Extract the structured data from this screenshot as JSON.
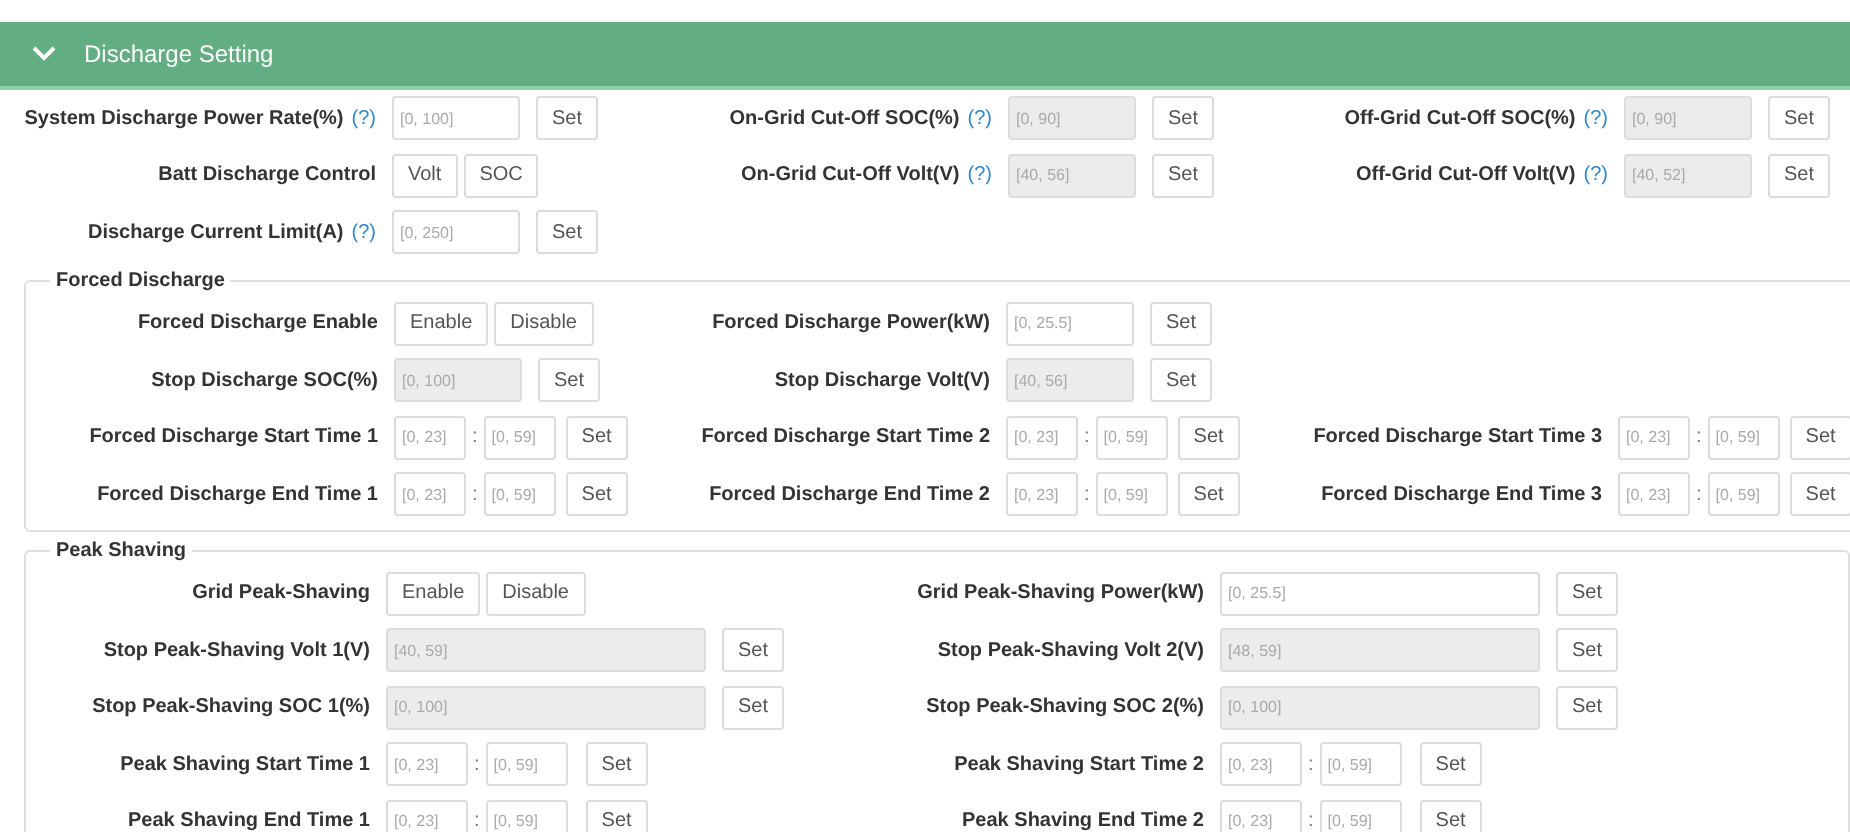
{
  "header": {
    "title": "Discharge Setting",
    "expanded": true
  },
  "sections": [
    {
      "rows": [
        [
          {
            "kind": "input",
            "label": "System Discharge Power Rate(%)",
            "help": "(?)",
            "placeholder": "[0, 100]",
            "disabled": false,
            "button": "Set"
          },
          {
            "kind": "input",
            "label": "On-Grid Cut-Off SOC(%)",
            "help": "(?)",
            "placeholder": "[0, 90]",
            "disabled": true,
            "button": "Set"
          },
          {
            "kind": "input",
            "label": "Off-Grid Cut-Off SOC(%)",
            "help": "(?)",
            "placeholder": "[0, 90]",
            "disabled": true,
            "button": "Set"
          }
        ],
        [
          {
            "kind": "toggle",
            "label": "Batt Discharge Control",
            "options": [
              "Volt",
              "SOC"
            ]
          },
          {
            "kind": "input",
            "label": "On-Grid Cut-Off Volt(V)",
            "help": "(?)",
            "placeholder": "[40, 56]",
            "disabled": true,
            "button": "Set"
          },
          {
            "kind": "input",
            "label": "Off-Grid Cut-Off Volt(V)",
            "help": "(?)",
            "placeholder": "[40, 52]",
            "disabled": true,
            "button": "Set"
          }
        ],
        [
          {
            "kind": "input",
            "label": "Discharge Current Limit(A)",
            "help": "(?)",
            "placeholder": "[0, 250]",
            "disabled": false,
            "button": "Set"
          }
        ]
      ]
    },
    {
      "legend": "Forced Discharge",
      "rows": [
        [
          {
            "kind": "toggle",
            "label": "Forced Discharge Enable",
            "options": [
              "Enable",
              "Disable"
            ]
          },
          {
            "kind": "input",
            "label": "Forced Discharge Power(kW)",
            "placeholder": "[0, 25.5]",
            "disabled": false,
            "button": "Set"
          }
        ],
        [
          {
            "kind": "input",
            "label": "Stop Discharge SOC(%)",
            "placeholder": "[0, 100]",
            "disabled": true,
            "button": "Set"
          },
          {
            "kind": "input",
            "label": "Stop Discharge Volt(V)",
            "placeholder": "[40, 56]",
            "disabled": true,
            "button": "Set"
          }
        ],
        [
          {
            "kind": "time",
            "label": "Forced Discharge Start Time 1",
            "hour": {
              "placeholder": "[0, 23]"
            },
            "separator": ":",
            "minute": {
              "placeholder": "[0, 59]"
            },
            "button": "Set"
          },
          {
            "kind": "time",
            "label": "Forced Discharge Start Time 2",
            "hour": {
              "placeholder": "[0, 23]"
            },
            "separator": ":",
            "minute": {
              "placeholder": "[0, 59]"
            },
            "button": "Set"
          },
          {
            "kind": "time",
            "label": "Forced Discharge Start Time 3",
            "hour": {
              "placeholder": "[0, 23]"
            },
            "separator": ":",
            "minute": {
              "placeholder": "[0, 59]"
            },
            "button": "Set"
          }
        ],
        [
          {
            "kind": "time",
            "label": "Forced Discharge End Time 1",
            "hour": {
              "placeholder": "[0, 23]"
            },
            "separator": ":",
            "minute": {
              "placeholder": "[0, 59]"
            },
            "button": "Set"
          },
          {
            "kind": "time",
            "label": "Forced Discharge End Time 2",
            "hour": {
              "placeholder": "[0, 23]"
            },
            "separator": ":",
            "minute": {
              "placeholder": "[0, 59]"
            },
            "button": "Set"
          },
          {
            "kind": "time",
            "label": "Forced Discharge End Time 3",
            "hour": {
              "placeholder": "[0, 23]"
            },
            "separator": ":",
            "minute": {
              "placeholder": "[0, 59]"
            },
            "button": "Set"
          }
        ]
      ]
    },
    {
      "legend": "Peak Shaving",
      "rows": [
        [
          {
            "kind": "toggle",
            "label": "Grid Peak-Shaving",
            "options": [
              "Enable",
              "Disable"
            ]
          },
          {
            "kind": "input",
            "label": "Grid Peak-Shaving Power(kW)",
            "placeholder": "[0, 25.5]",
            "disabled": false,
            "button": "Set"
          }
        ],
        [
          {
            "kind": "input",
            "label": "Stop Peak-Shaving Volt 1(V)",
            "placeholder": "[40, 59]",
            "disabled": true,
            "button": "Set"
          },
          {
            "kind": "input",
            "label": "Stop Peak-Shaving Volt 2(V)",
            "placeholder": "[48, 59]",
            "disabled": true,
            "button": "Set"
          }
        ],
        [
          {
            "kind": "input",
            "label": "Stop Peak-Shaving SOC 1(%)",
            "placeholder": "[0, 100]",
            "disabled": true,
            "button": "Set"
          },
          {
            "kind": "input",
            "label": "Stop Peak-Shaving SOC 2(%)",
            "placeholder": "[0, 100]",
            "disabled": true,
            "button": "Set"
          }
        ],
        [
          {
            "kind": "time",
            "label": "Peak Shaving Start Time 1",
            "hour": {
              "placeholder": "[0, 23]"
            },
            "separator": ":",
            "minute": {
              "placeholder": "[0, 59]"
            },
            "button": "Set"
          },
          {
            "kind": "time",
            "label": "Peak Shaving Start Time 2",
            "hour": {
              "placeholder": "[0, 23]"
            },
            "separator": ":",
            "minute": {
              "placeholder": "[0, 59]"
            },
            "button": "Set"
          }
        ],
        [
          {
            "kind": "time",
            "label": "Peak Shaving End Time 1",
            "hour": {
              "placeholder": "[0, 23]"
            },
            "separator": ":",
            "minute": {
              "placeholder": "[0, 59]"
            },
            "button": "Set"
          },
          {
            "kind": "time",
            "label": "Peak Shaving End Time 2",
            "hour": {
              "placeholder": "[0, 23]"
            },
            "separator": ":",
            "minute": {
              "placeholder": "[0, 59]"
            },
            "button": "Set"
          }
        ]
      ]
    }
  ]
}
